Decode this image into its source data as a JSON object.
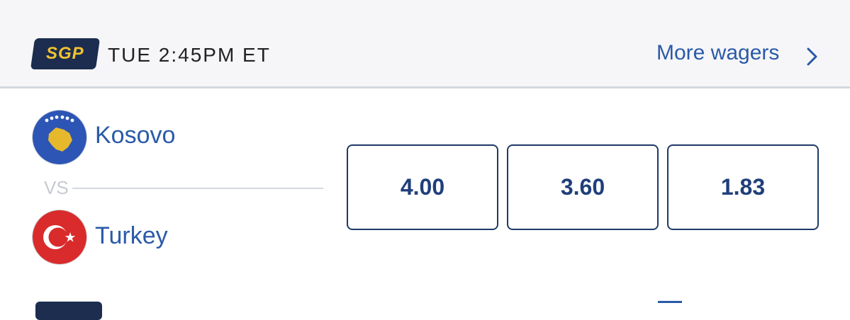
{
  "header": {
    "sgp_label": "SGP",
    "game_time": "TUE 2:45PM ET",
    "more_wagers": "More wagers",
    "chevron_icon": "chevron-right-icon"
  },
  "teams": {
    "home": {
      "name": "Kosovo",
      "flag_icon": "kosovo-flag-icon"
    },
    "away": {
      "name": "Turkey",
      "flag_icon": "turkey-flag-icon"
    },
    "vs": "VS"
  },
  "odds": [
    "4.00",
    "3.60",
    "1.83"
  ],
  "colors": {
    "link_blue": "#2a5aa8",
    "odds_text": "#1f3f7a",
    "navy": "#1c2d4f",
    "sgp_yellow": "#f2c230",
    "header_bg": "#f6f6f8"
  }
}
